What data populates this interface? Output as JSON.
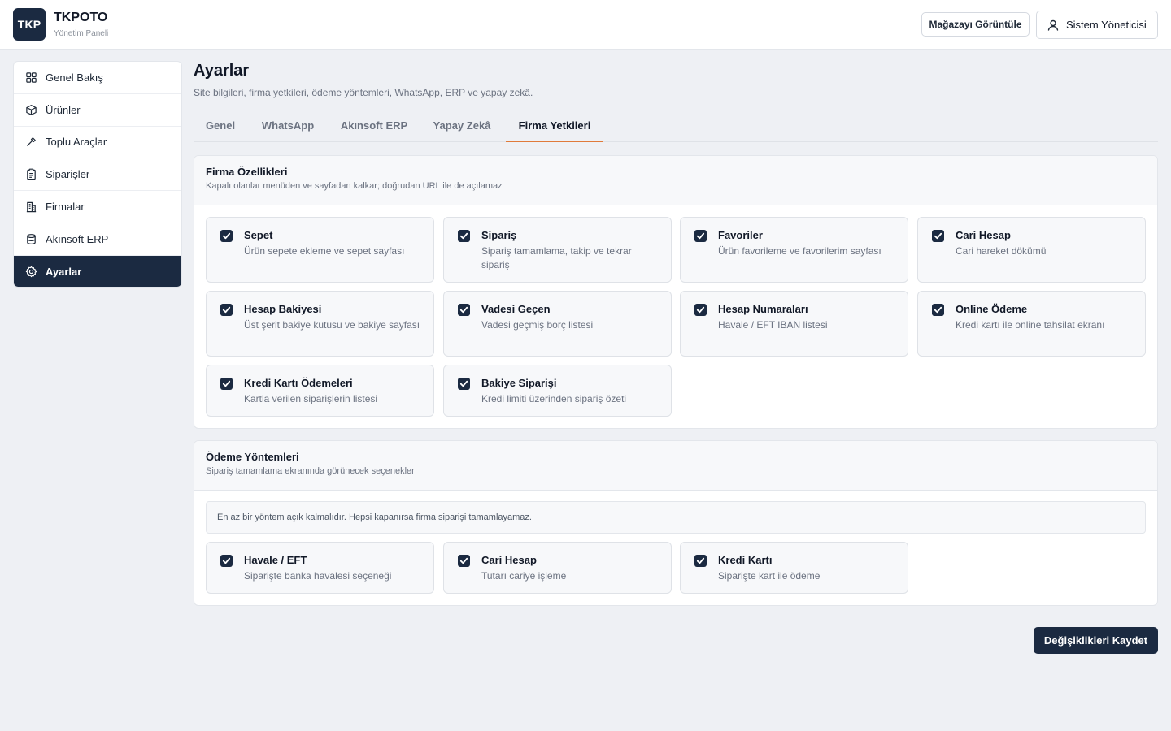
{
  "app": {
    "logo_text": "TKP",
    "name": "TKPOTO",
    "subtitle": "Yönetim Paneli"
  },
  "header": {
    "view_store_label": "Mağazayı Görüntüle",
    "user_label": "Sistem Yöneticisi"
  },
  "sidebar": {
    "items": [
      {
        "label": "Genel Bakış",
        "icon": "grid-icon"
      },
      {
        "label": "Ürünler",
        "icon": "box-icon"
      },
      {
        "label": "Toplu Araçlar",
        "icon": "tool-icon"
      },
      {
        "label": "Siparişler",
        "icon": "clipboard-icon"
      },
      {
        "label": "Firmalar",
        "icon": "building-icon"
      },
      {
        "label": "Akınsoft ERP",
        "icon": "database-icon"
      },
      {
        "label": "Ayarlar",
        "icon": "gear-icon",
        "active": true
      }
    ]
  },
  "page": {
    "title": "Ayarlar",
    "description": "Site bilgileri, firma yetkileri, ödeme yöntemleri, WhatsApp, ERP ve yapay zekâ."
  },
  "tabs": [
    {
      "label": "Genel"
    },
    {
      "label": "WhatsApp"
    },
    {
      "label": "Akınsoft ERP"
    },
    {
      "label": "Yapay Zekâ"
    },
    {
      "label": "Firma Yetkileri",
      "active": true
    }
  ],
  "features": {
    "title": "Firma Özellikleri",
    "subtitle": "Kapalı olanlar menüden ve sayfadan kalkar; doğrudan URL ile de açılamaz",
    "items": [
      {
        "title": "Sepet",
        "desc": "Ürün sepete ekleme ve sepet sayfası",
        "checked": true
      },
      {
        "title": "Sipariş",
        "desc": "Sipariş tamamlama, takip ve tekrar sipariş",
        "checked": true
      },
      {
        "title": "Favoriler",
        "desc": "Ürün favorileme ve favorilerim sayfası",
        "checked": true
      },
      {
        "title": "Cari Hesap",
        "desc": "Cari hareket dökümü",
        "checked": true
      },
      {
        "title": "Hesap Bakiyesi",
        "desc": "Üst şerit bakiye kutusu ve bakiye sayfası",
        "checked": true
      },
      {
        "title": "Vadesi Geçen",
        "desc": "Vadesi geçmiş borç listesi",
        "checked": true
      },
      {
        "title": "Hesap Numaraları",
        "desc": "Havale / EFT IBAN listesi",
        "checked": true
      },
      {
        "title": "Online Ödeme",
        "desc": "Kredi kartı ile online tahsilat ekranı",
        "checked": true
      },
      {
        "title": "Kredi Kartı Ödemeleri",
        "desc": "Kartla verilen siparişlerin listesi",
        "checked": true
      },
      {
        "title": "Bakiye Siparişi",
        "desc": "Kredi limiti üzerinden sipariş özeti",
        "checked": true
      }
    ]
  },
  "payments": {
    "title": "Ödeme Yöntemleri",
    "subtitle": "Sipariş tamamlama ekranında görünecek seçenekler",
    "notice": "En az bir yöntem açık kalmalıdır. Hepsi kapanırsa firma siparişi tamamlayamaz.",
    "items": [
      {
        "title": "Havale / EFT",
        "desc": "Siparişte banka havalesi seçeneği",
        "checked": true
      },
      {
        "title": "Cari Hesap",
        "desc": "Tutarı cariye işleme",
        "checked": true
      },
      {
        "title": "Kredi Kartı",
        "desc": "Siparişte kart ile ödeme",
        "checked": true
      }
    ]
  },
  "actions": {
    "save_label": "Değişiklikleri Kaydet"
  },
  "colors": {
    "primary": "#1b2a41",
    "accent_tab": "#e07a3a",
    "background": "#eef0f4"
  }
}
